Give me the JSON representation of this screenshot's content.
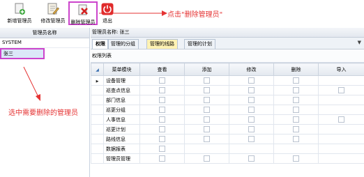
{
  "toolbar": {
    "add_label": "新增管理员",
    "edit_label": "修改管理员",
    "delete_label": "删除管理员",
    "exit_label": "退出"
  },
  "annotations": {
    "click_delete": "点击\"删除管理员\"",
    "select_admin": "选中需要删除的管理员"
  },
  "admin_list": {
    "header": "管理员名称",
    "items": [
      "SYSTEM",
      "张三"
    ]
  },
  "detail": {
    "title": "管理员名称: 张三",
    "tabs": [
      "权限",
      "管理的分组",
      "管理的线路",
      "管理的计划"
    ],
    "section_label": "权限列表",
    "columns": [
      "菜单模块",
      "查看",
      "添加",
      "修改",
      "删除",
      "导入"
    ],
    "rows": [
      {
        "name": "设备管理",
        "checks": [
          true,
          true,
          true,
          true,
          false
        ]
      },
      {
        "name": "巡查点信息",
        "checks": [
          true,
          true,
          true,
          true,
          true
        ]
      },
      {
        "name": "部门信息",
        "checks": [
          true,
          true,
          true,
          true,
          false
        ]
      },
      {
        "name": "巡更分组",
        "checks": [
          true,
          true,
          true,
          true,
          false
        ]
      },
      {
        "name": "人事信息",
        "checks": [
          true,
          true,
          true,
          true,
          true
        ]
      },
      {
        "name": "巡更计划",
        "checks": [
          true,
          true,
          true,
          true,
          false
        ]
      },
      {
        "name": "路线信息",
        "checks": [
          true,
          true,
          true,
          true,
          false
        ]
      },
      {
        "name": "数据报表",
        "checks": [
          true,
          false,
          false,
          false,
          false
        ]
      },
      {
        "name": "管理员管理",
        "checks": [
          true,
          true,
          true,
          true,
          false
        ]
      }
    ]
  },
  "colors": {
    "highlight_border": "#cc44cc",
    "annotation": "#e53333",
    "tab_highlight": "#fff2b3"
  }
}
